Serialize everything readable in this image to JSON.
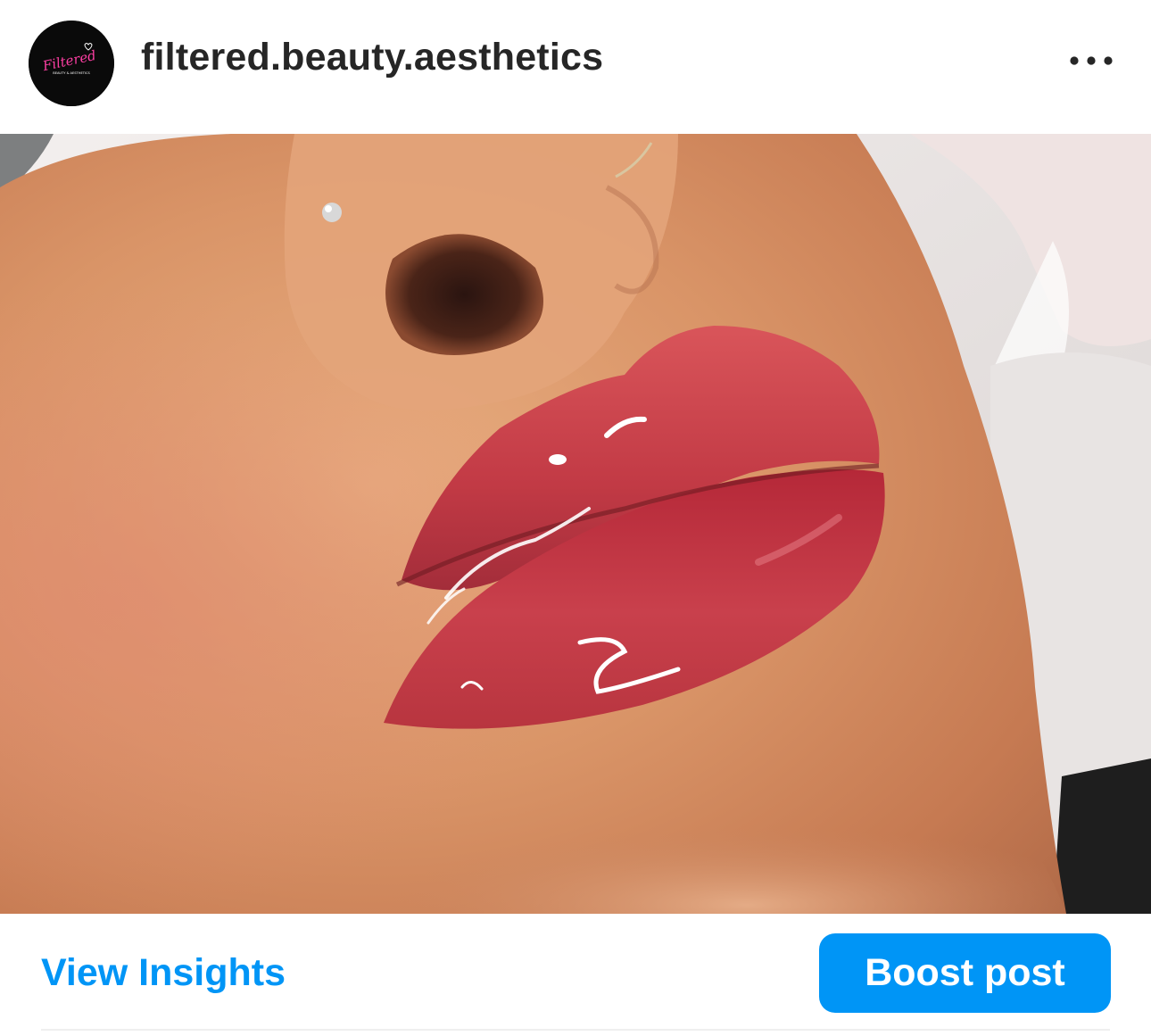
{
  "post": {
    "username": "filtered.beauty.aesthetics",
    "avatar": {
      "logo_text": "Filtered",
      "logo_subtext": "BEAUTY & AESTHETICS",
      "background_color": "#0a0a0a",
      "accent_color": "#ff3fa4"
    },
    "more_icon": "more-horizontal-icon",
    "image": {
      "subject": "photo"
    }
  },
  "actions": {
    "view_insights_label": "View Insights",
    "boost_post_label": "Boost post",
    "accent_color": "#0095f6"
  }
}
